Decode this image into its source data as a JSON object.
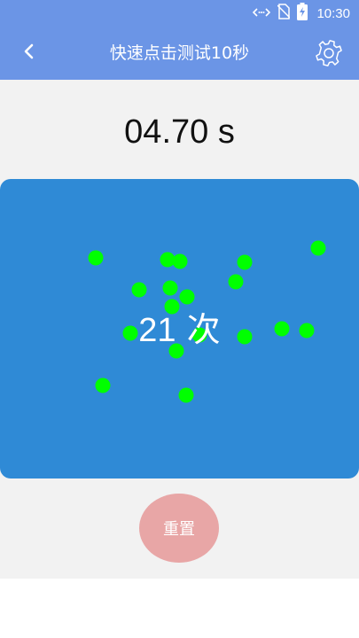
{
  "status_bar": {
    "time": "10:30"
  },
  "header": {
    "title": "快速点击测试10秒",
    "back_icon": "chevron-left-icon",
    "settings_icon": "gear-icon"
  },
  "timer": {
    "value": "04.70 s"
  },
  "tap_area": {
    "count": "21",
    "unit": "次",
    "color": "#2f8ad6",
    "dot_color": "#00ff00"
  },
  "reset_button": {
    "label": "重置",
    "color": "#e8a6a6"
  },
  "colors": {
    "accent": "#6b95e6",
    "background": "#f2f2f2"
  }
}
